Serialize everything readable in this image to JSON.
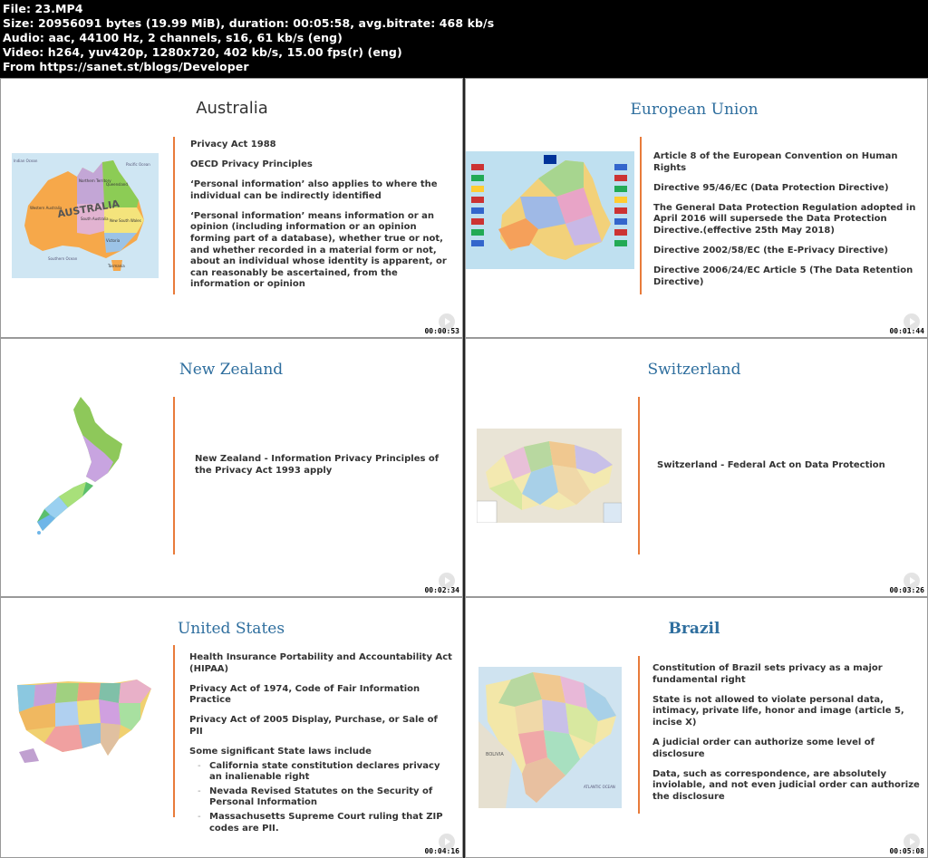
{
  "header": {
    "line1": "File: 23.MP4",
    "line2": "Size: 20956091 bytes (19.99 MiB), duration: 00:05:58, avg.bitrate: 468 kb/s",
    "line3": "Audio: aac, 44100 Hz, 2 channels, s16, 61 kb/s (eng)",
    "line4": "Video: h264, yuv420p, 1280x720, 402 kb/s, 15.00 fps(r) (eng)",
    "line5": "From https://sanet.st/blogs/Developer"
  },
  "slides": {
    "australia": {
      "title": "Australia",
      "timestamp": "00:00:53",
      "points": [
        "Privacy Act 1988",
        "OECD Privacy Principles",
        "‘Personal information’ also applies to where the individual can be indirectly identified",
        "‘Personal information’ means information or an opinion (including information or an opinion forming part of a database), whether true or not, and whether recorded in a material form or not, about an individual whose identity is apparent, or can reasonably be ascertained, from the information or opinion"
      ],
      "map_labels": {
        "country": "AUSTRALIA",
        "indian_ocean": "Indian Ocean",
        "pacific_ocean": "Pacific Ocean",
        "southern_ocean": "Southern Ocean",
        "wa": "Western Australia",
        "nt": "Northern Territory",
        "qld": "Queensland",
        "sa": "South Australia",
        "nsw": "New South Wales",
        "vic": "Victoria",
        "tas": "Tasmania"
      }
    },
    "eu": {
      "title": "European Union",
      "timestamp": "00:01:44",
      "points": [
        "Article 8 of the European Convention on Human Rights",
        "Directive 95/46/EC (Data Protection Directive)",
        "The General Data Protection Regulation adopted in April 2016 will supersede the Data Protection Directive.(effective 25th May 2018)",
        "Directive 2002/58/EC (the E-Privacy Directive)",
        "Directive 2006/24/EC Article 5 (The Data Retention Directive)"
      ]
    },
    "nz": {
      "title": "New Zealand",
      "timestamp": "00:02:34",
      "points": [
        "New Zealand - Information Privacy Principles of the Privacy Act 1993 apply"
      ]
    },
    "ch": {
      "title": "Switzerland",
      "timestamp": "00:03:26",
      "points": [
        "Switzerland - Federal Act on Data Protection"
      ]
    },
    "us": {
      "title": "United States",
      "timestamp": "00:04:16",
      "points": [
        "Health Insurance Portability and Accountability Act (HIPAA)",
        "Privacy Act of 1974, Code of Fair Information Practice",
        "Privacy Act of 2005 Display, Purchase, or Sale of PII",
        "Some significant State laws include"
      ],
      "subpoints": [
        "California state constitution declares privacy an inalienable right",
        "Nevada Revised Statutes on the Security of Personal Information",
        "Massachusetts Supreme Court ruling that ZIP codes are PII."
      ]
    },
    "br": {
      "title": "Brazil",
      "timestamp": "00:05:08",
      "points": [
        "Constitution of Brazil sets privacy as a major fundamental right",
        "State is not allowed to violate personal data, intimacy, private life, honor and image (article 5, incise X)",
        "A judicial order can authorize some level of disclosure",
        "Data, such as correspondence, are absolutely inviolable, and not even judicial order can authorize the disclosure"
      ],
      "map_labels": {
        "bolivia": "BOLIVIA",
        "atlantic": "ATLANTIC OCEAN"
      }
    }
  },
  "colors": {
    "title_blue": "#2e6e9e",
    "divider_orange": "#e87b3a",
    "text": "#333333"
  }
}
